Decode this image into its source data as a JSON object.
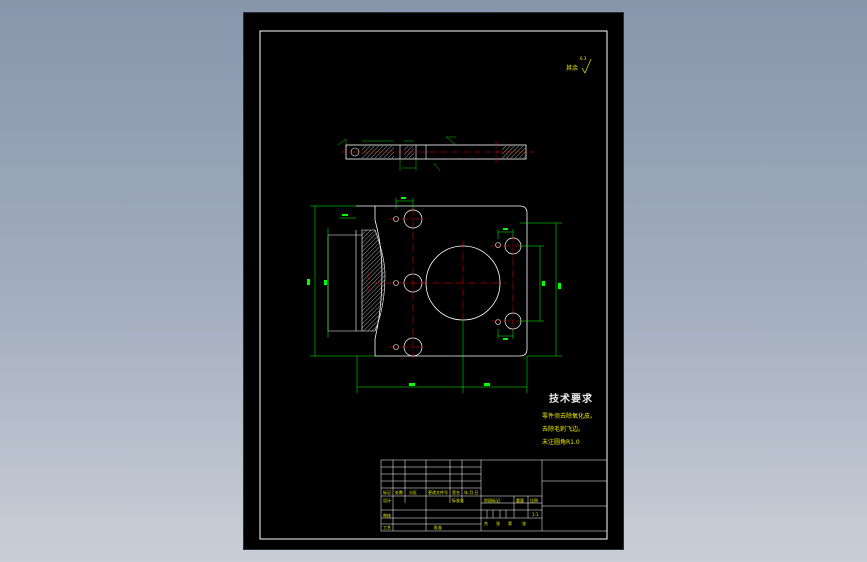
{
  "drawing": {
    "roughness_note": "其余",
    "roughness_value": "6.3",
    "tech_title": "技术要求",
    "tech_notes": [
      "零件须去除氧化皮。",
      "去除毛刺飞边。",
      "未注圆角R1.0"
    ]
  },
  "title_block": {
    "row1": [
      "标记",
      "处数",
      "分区",
      "更改文件号",
      "签名",
      "年.月.日"
    ],
    "row2": [
      "设计",
      "",
      "标准化",
      "阶段标记",
      "重量",
      "比例"
    ],
    "row3": [
      "审核"
    ],
    "row4": [
      "工艺",
      "",
      "批准",
      "共",
      "张",
      "第",
      "张"
    ],
    "scale": "1:1"
  },
  "colors": {
    "background": "#000000",
    "outline": "#ffffff",
    "dimension": "#00ff00",
    "centerline": "#ff0000",
    "annotation": "#f0f000"
  }
}
